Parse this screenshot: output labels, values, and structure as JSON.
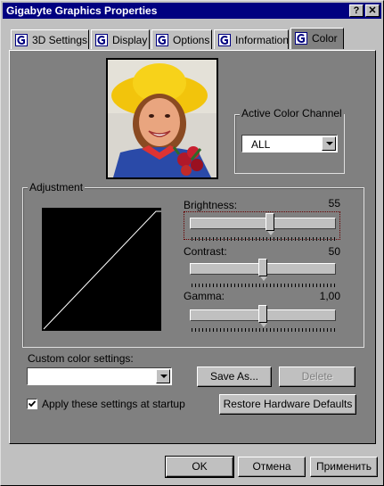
{
  "window": {
    "title": "Gigabyte Graphics Properties",
    "help_label": "?",
    "close_label": "✕"
  },
  "tabs": [
    {
      "label": "3D Settings",
      "icon": "gigabyte-g-icon"
    },
    {
      "label": "Display",
      "icon": "gigabyte-g-icon"
    },
    {
      "label": "Options",
      "icon": "gigabyte-g-icon"
    },
    {
      "label": "Information",
      "icon": "gigabyte-g-icon"
    },
    {
      "label": "Color",
      "icon": "gigabyte-g-icon",
      "active": true
    }
  ],
  "color": {
    "active_channel": {
      "label": "Active Color Channel",
      "value": "ALL"
    },
    "adjustment": {
      "label": "Adjustment",
      "brightness": {
        "label": "Brightness:",
        "value": "55",
        "fraction": 0.55
      },
      "contrast": {
        "label": "Contrast:",
        "value": "50",
        "fraction": 0.5
      },
      "gamma": {
        "label": "Gamma:",
        "value": "1,00",
        "fraction": 0.5
      }
    },
    "custom_settings": {
      "label": "Custom color settings:",
      "value": ""
    },
    "save_as_label": "Save As...",
    "delete_label": "Delete",
    "apply_startup": {
      "label": "Apply these settings at startup",
      "checked": true
    },
    "restore_label": "Restore Hardware Defaults"
  },
  "footer": {
    "ok_label": "OK",
    "cancel_label": "Отмена",
    "apply_label": "Применить"
  },
  "colors": {
    "titlebar": "#000080",
    "panel": "#808080",
    "face": "#c0c0c0"
  }
}
